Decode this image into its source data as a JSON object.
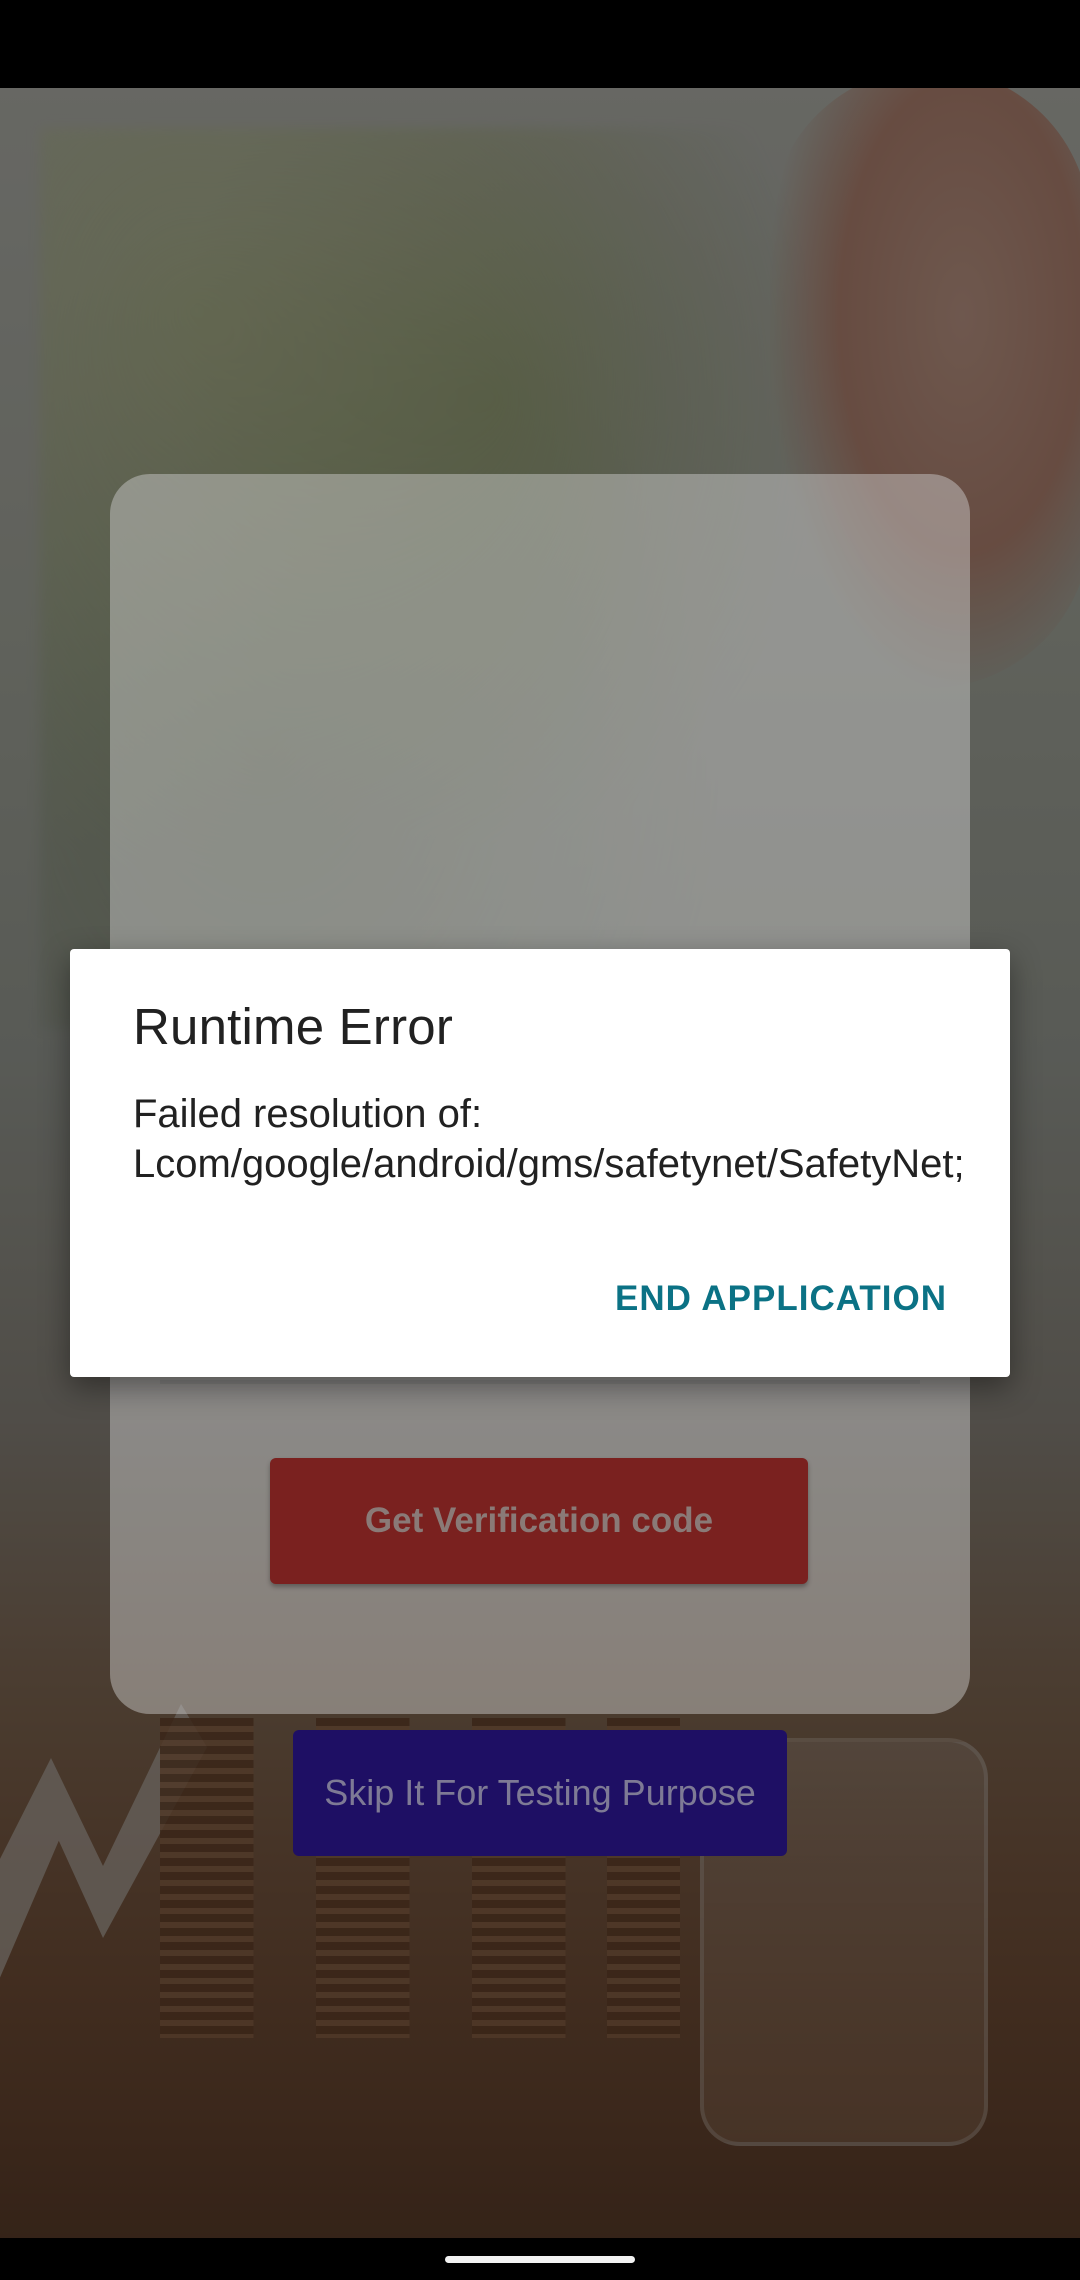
{
  "background": {
    "card": {
      "verify_button_label": "Get Verification code"
    },
    "skip_button_label": "Skip It For Testing Purpose"
  },
  "dialog": {
    "title": "Runtime Error",
    "message": "Failed resolution of: Lcom/google/android/gms/safetynet/SafetyNet;",
    "action_label": "END APPLICATION"
  },
  "colors": {
    "dialog_action": "#0b7285",
    "verify_button": "#c62828",
    "skip_button": "#3d1fc7"
  }
}
